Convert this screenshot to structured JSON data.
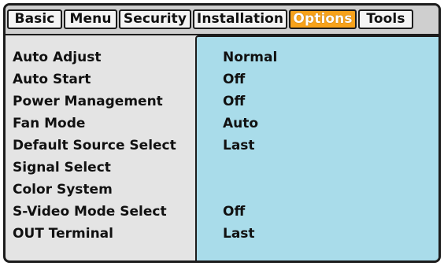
{
  "tabs": [
    {
      "label": "Basic",
      "active": false
    },
    {
      "label": "Menu",
      "active": false
    },
    {
      "label": "Security",
      "active": false
    },
    {
      "label": "Installation",
      "active": false
    },
    {
      "label": "Options",
      "active": true
    },
    {
      "label": "Tools",
      "active": false
    }
  ],
  "settings": [
    {
      "label": "Auto Adjust",
      "value": "Normal"
    },
    {
      "label": "Auto Start",
      "value": "Off"
    },
    {
      "label": "Power Management",
      "value": "Off"
    },
    {
      "label": "Fan Mode",
      "value": "Auto"
    },
    {
      "label": "Default Source Select",
      "value": "Last"
    },
    {
      "label": "Signal Select",
      "value": ""
    },
    {
      "label": "Color System",
      "value": ""
    },
    {
      "label": "S-Video Mode Select",
      "value": "Off"
    },
    {
      "label": "OUT Terminal",
      "value": "Last"
    }
  ],
  "colors": {
    "active_tab": "#f7a21b",
    "value_panel": "#a9dcea",
    "label_panel": "#e4e4e4"
  }
}
